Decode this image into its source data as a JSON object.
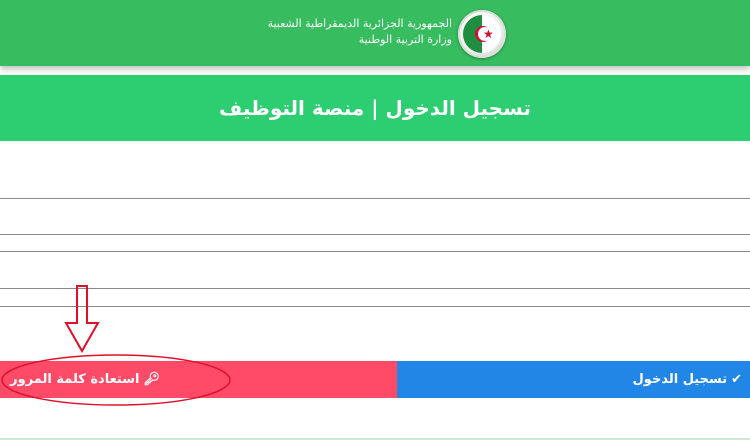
{
  "header": {
    "line1": "الجمهورية الجزائرية الديمقراطية الشعبية",
    "line2": "وزارة التربية الوطنية",
    "logo_icon": "algeria-flag-emblem-icon"
  },
  "title": "تسجيل الدخول | منصة التوظيف",
  "buttons": {
    "login_label": "تسجيل الدخول",
    "login_icon": "check-icon",
    "recover_label": "استعادة كلمة المرور",
    "recover_icon": "key-icon"
  },
  "colors": {
    "header_green": "#37bd5f",
    "title_green": "#2dcd71",
    "login_blue": "#2186e6",
    "recover_pink": "#ff4b68",
    "annotation_red": "#e0102a"
  }
}
